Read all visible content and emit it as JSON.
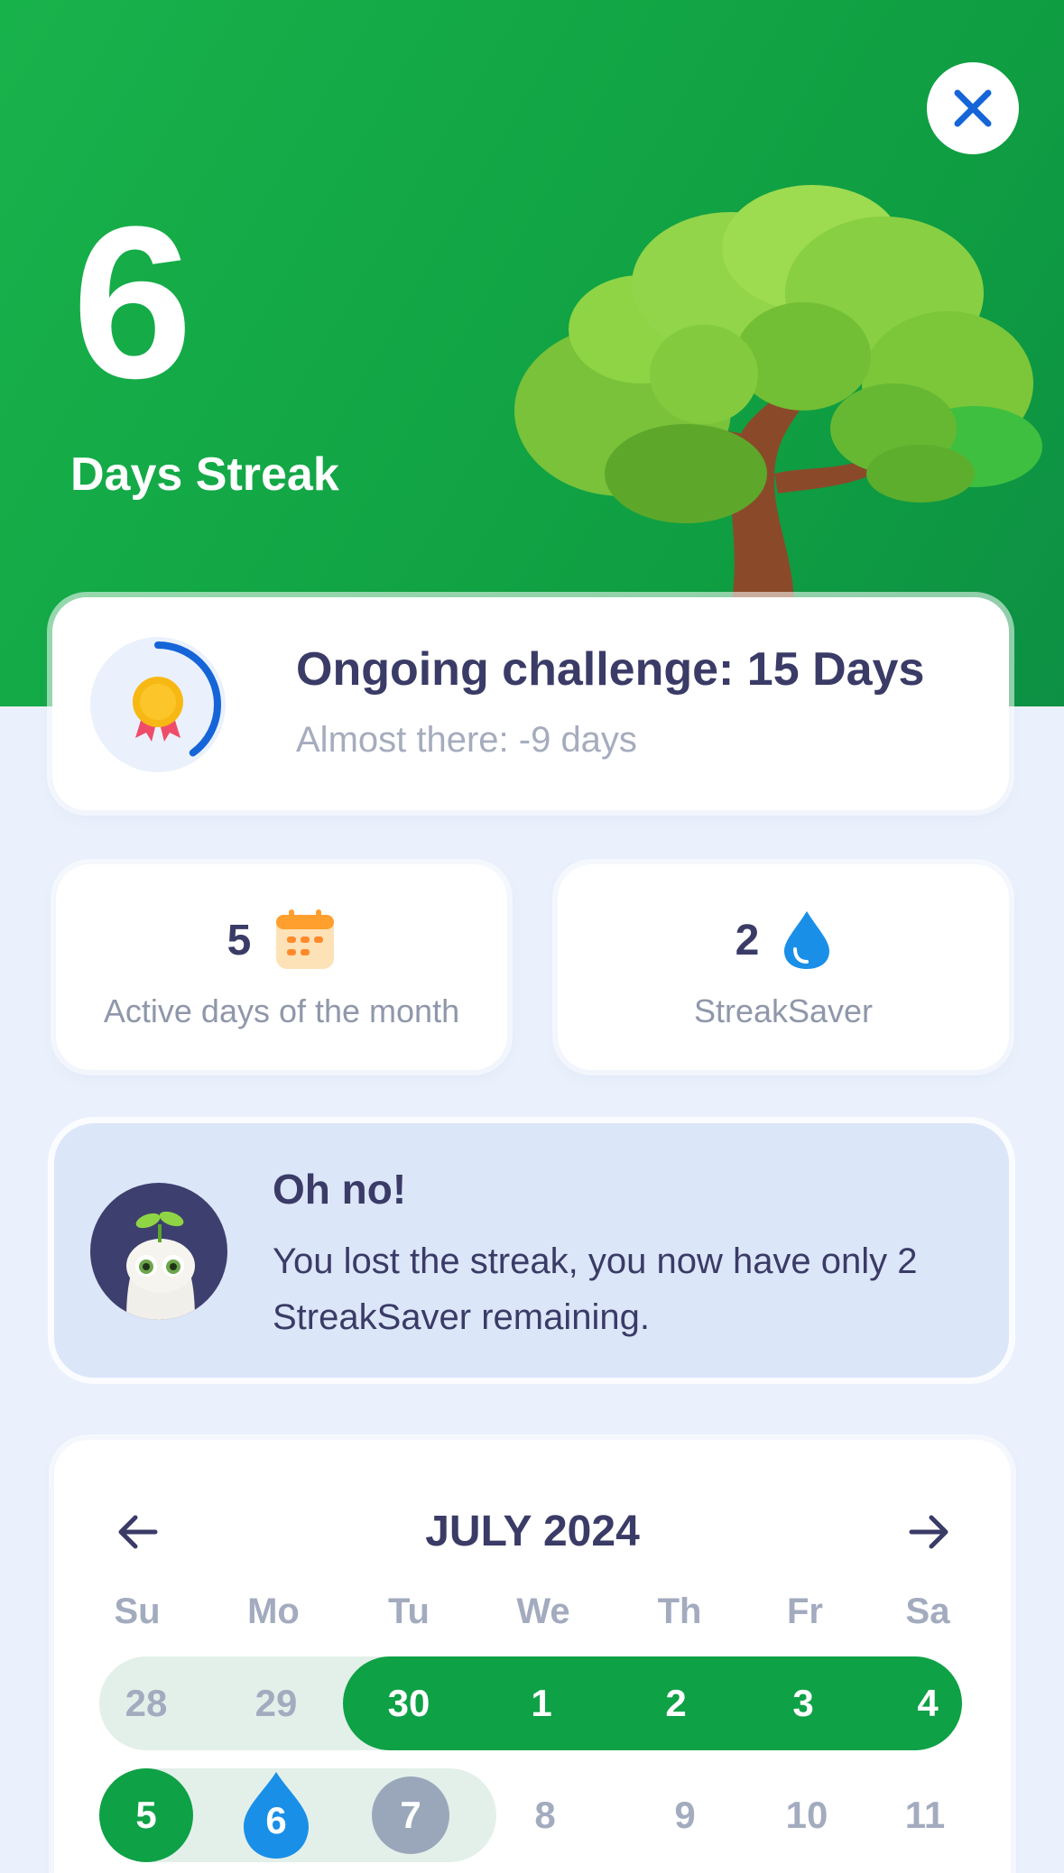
{
  "colors": {
    "hero_green": "#18b24b",
    "accent_blue": "#1565d8",
    "text_dark": "#3a3b66",
    "muted": "#a5acbd",
    "streak_green": "#0ea146"
  },
  "header": {
    "streak_number": "6",
    "streak_label": "Days Streak",
    "close_icon": "close-icon",
    "illustration": "tree-illustration"
  },
  "challenge": {
    "title": "Ongoing challenge: 15 Days",
    "subtitle": "Almost there: -9 days",
    "progress_fraction": 0.4,
    "icon": "medal-icon"
  },
  "stats": [
    {
      "value": "5",
      "label": "Active days of the month",
      "icon": "calendar-icon"
    },
    {
      "value": "2",
      "label": "StreakSaver",
      "icon": "water-drop-icon"
    }
  ],
  "alert": {
    "title": "Oh no!",
    "message": "You lost the streak, you now have only 2 StreakSaver remaining.",
    "avatar": "sprout-character-avatar"
  },
  "calendar": {
    "month": "JULY 2024",
    "prev_icon": "arrow-left-icon",
    "next_icon": "arrow-right-icon",
    "weekdays": [
      "Su",
      "Mo",
      "Tu",
      "We",
      "Th",
      "Fr",
      "Sa"
    ],
    "week1": [
      "28",
      "29",
      "30",
      "1",
      "2",
      "3",
      "4"
    ],
    "week2": [
      "5",
      "6",
      "7",
      "8",
      "9",
      "10",
      "11"
    ]
  }
}
